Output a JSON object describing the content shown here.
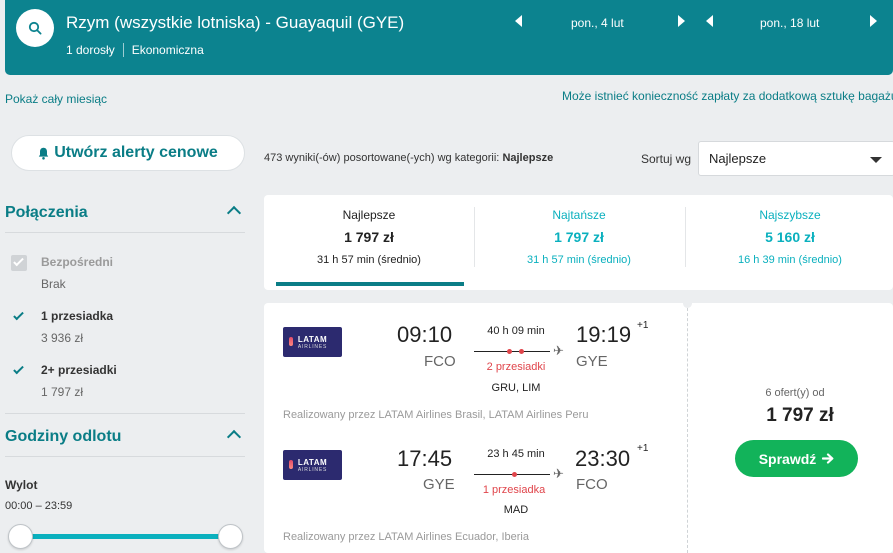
{
  "header": {
    "route": "Rzym (wszystkie lotniska) - Guayaquil (GYE)",
    "passengers": "1 dorosły",
    "cabin_class": "Ekonomiczna",
    "depart_date": "pon., 4 lut",
    "return_date": "pon., 18 lut"
  },
  "links": {
    "whole_month": "Pokaż cały miesiąc",
    "baggage_notice": "Może istnieć konieczność zapłaty za dodatkową sztukę bagażu"
  },
  "alert_button": "Utwórz alerty cenowe",
  "results": {
    "count_text": "473 wyniki(-ów) posortowane(-ych) wg kategorii: ",
    "count_category": "Najlepsze",
    "sort_label": "Sortuj wg",
    "sort_value": "Najlepsze"
  },
  "filters": {
    "connections_title": "Połączenia",
    "direct_label": "Bezpośredni",
    "direct_sub": "Brak",
    "one_stop_label": "1 przesiadka",
    "one_stop_price": "3 936 zł",
    "two_plus_label": "2+ przesiadki",
    "two_plus_price": "1 797 zł",
    "departure_hours_title": "Godziny odlotu",
    "departure_label": "Wylot",
    "departure_range": "00:00 – 23:59"
  },
  "tabs": [
    {
      "title": "Najlepsze",
      "price": "1 797 zł",
      "time": "31 h 57 min (średnio)"
    },
    {
      "title": "Najtańsze",
      "price": "1 797 zł",
      "time": "31 h 57 min (średnio)"
    },
    {
      "title": "Najszybsze",
      "price": "5 160 zł",
      "time": "16 h 39 min (średnio)"
    }
  ],
  "result_card": {
    "outbound": {
      "airline_logo_text": "LATAM",
      "airline_logo_sub": "AIRLINES",
      "depart_time": "09:10",
      "depart_code": "FCO",
      "duration": "40 h 09 min",
      "stops": "2 przesiadki",
      "via": "GRU, LIM",
      "arrive_time": "19:19",
      "day_offset": "+1",
      "arrive_code": "GYE",
      "operated_by": "Realizowany przez LATAM Airlines Brasil, LATAM Airlines Peru"
    },
    "inbound": {
      "airline_logo_text": "LATAM",
      "airline_logo_sub": "AIRLINES",
      "depart_time": "17:45",
      "depart_code": "GYE",
      "duration": "23 h 45 min",
      "stops": "1 przesiadka",
      "via": "MAD",
      "arrive_time": "23:30",
      "day_offset": "+1",
      "arrive_code": "FCO",
      "operated_by": "Realizowany przez LATAM Airlines Ecuador, Iberia"
    },
    "offers": "6 ofert(y) od",
    "price": "1 797 zł",
    "check_button": "Sprawdź"
  },
  "colors": {
    "header_bg": "#0c838f",
    "accent": "#0a7d86",
    "stops_red": "#e0454b",
    "cta_green": "#12b35a"
  }
}
